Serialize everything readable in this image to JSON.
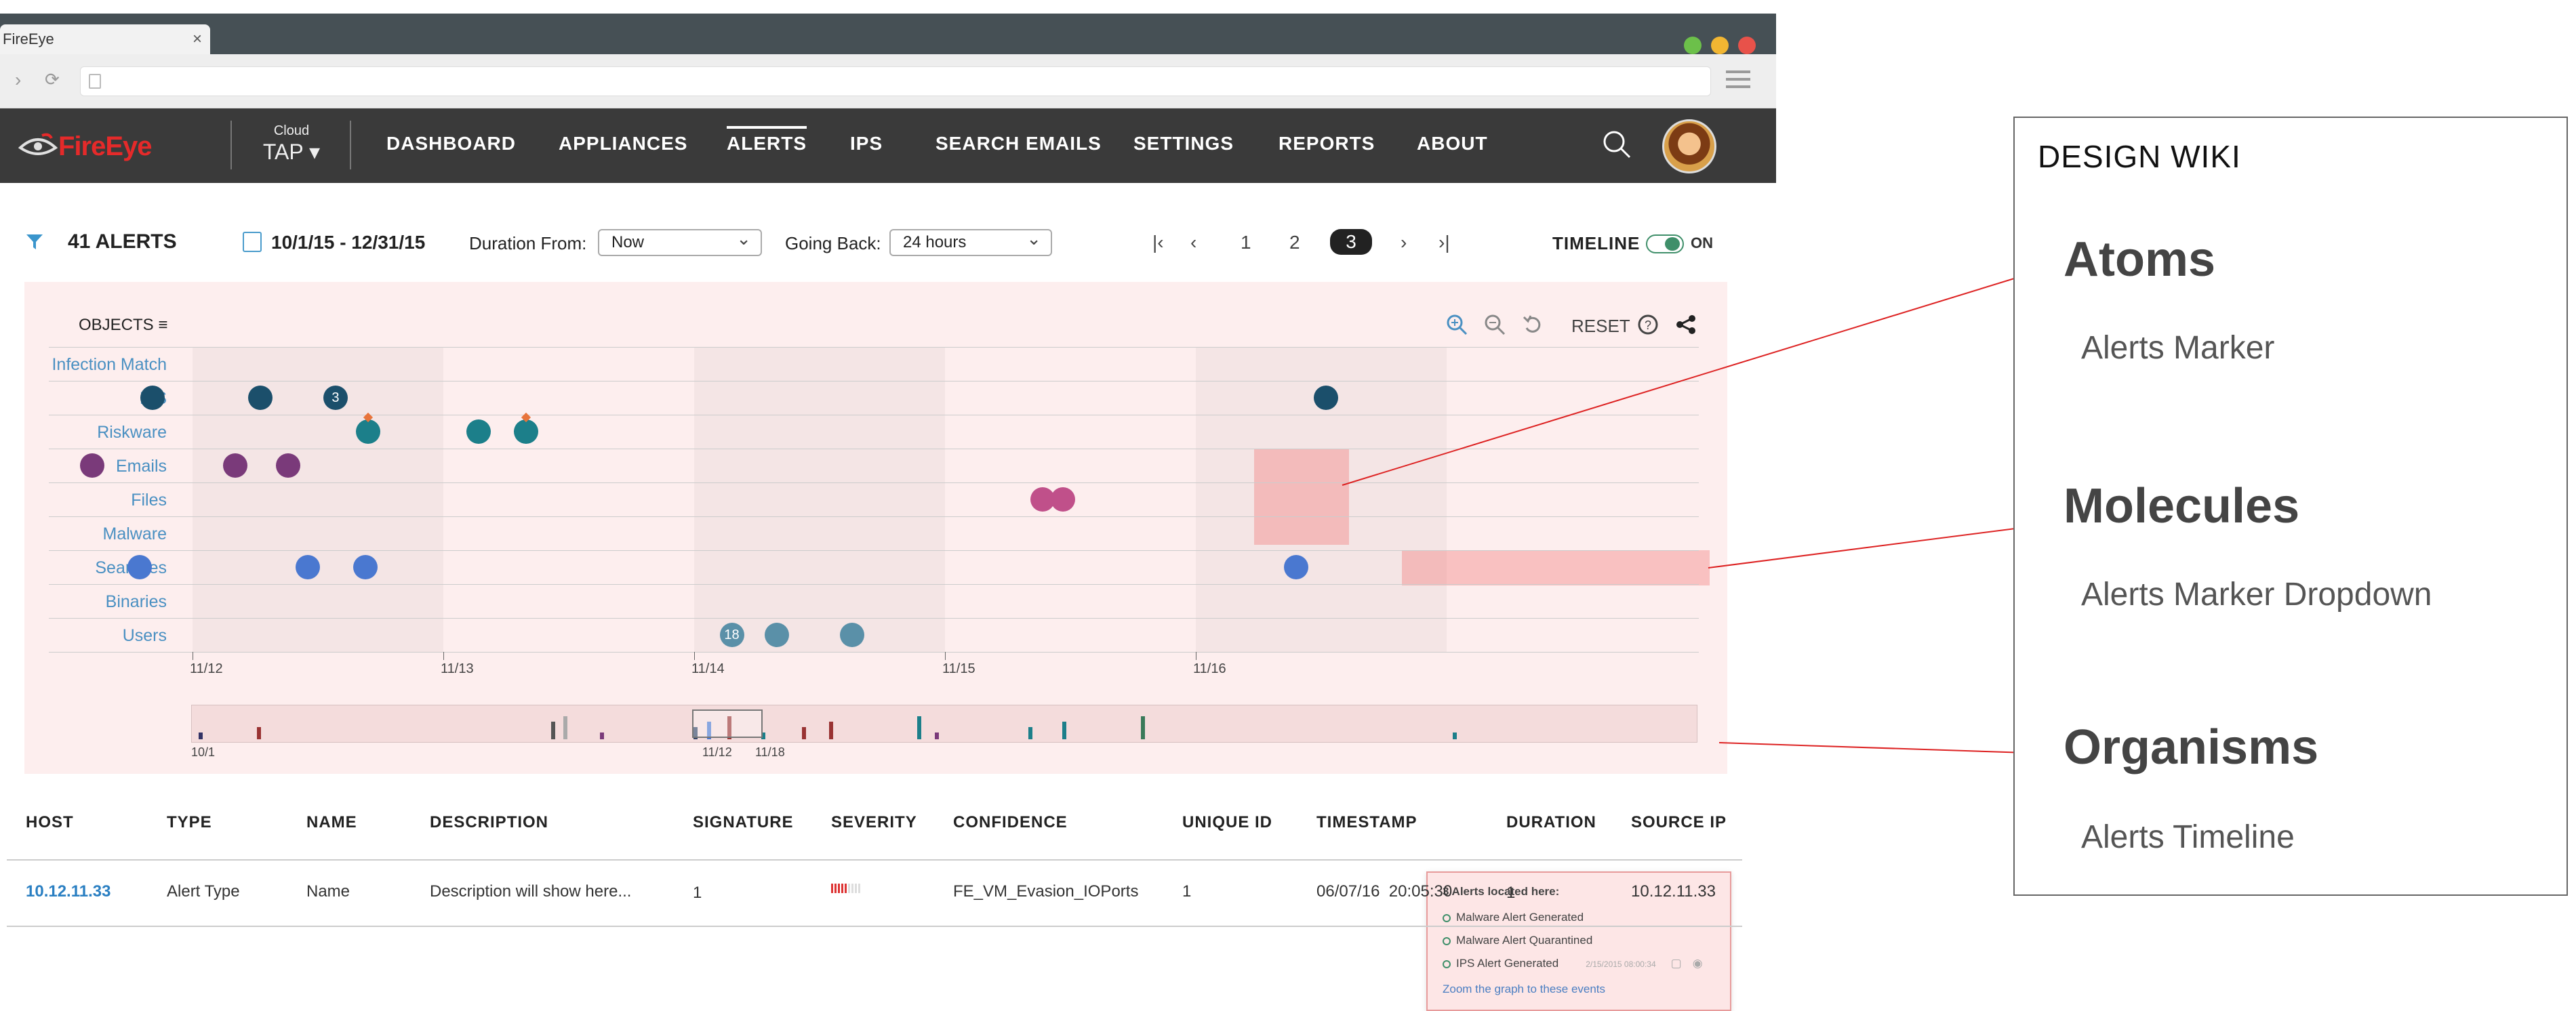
{
  "browser": {
    "tab_title": "FireEye",
    "tab_close": "×",
    "back": "›",
    "reload": "⟳"
  },
  "nav": {
    "logo_text": "FireEye",
    "cloud_small": "Cloud",
    "cloud_big": "TAP ▾",
    "items": [
      "DASHBOARD",
      "APPLIANCES",
      "ALERTS",
      "IPS",
      "SEARCH EMAILS",
      "SETTINGS",
      "REPORTS",
      "ABOUT"
    ],
    "active": "ALERTS"
  },
  "filters": {
    "alerts_count": "41 ALERTS",
    "date_range": "10/1/15 - 12/31/15",
    "duration_label": "Duration From:",
    "duration_value": "Now",
    "going_back_label": "Going Back:",
    "going_back_value": "24 hours",
    "pages": [
      "1",
      "2",
      "3"
    ],
    "current_page": "3",
    "timeline_label": "TIMELINE",
    "timeline_state": "ON"
  },
  "chart_data": {
    "type": "scatter",
    "objects_label": "OBJECTS ≡",
    "tools": {
      "reset": "RESET"
    },
    "categories": [
      "Infection Match",
      "IPS",
      "Riskware",
      "Emails",
      "Files",
      "Malware",
      "Searches",
      "Binaries",
      "Users"
    ],
    "x_ticks": [
      "11/12",
      "11/13",
      "11/14",
      "11/15",
      "11/16"
    ],
    "series_colors": {
      "IPS": "#1b4f6b",
      "Riskware": "#1c7f8a",
      "Emails": "#7a3a7a",
      "Files": "#c0508a",
      "Searches": "#4a78d0",
      "Users": "#5a90a8"
    },
    "points": [
      {
        "cat": "IPS",
        "x": 11.84
      },
      {
        "cat": "IPS",
        "x": 12.27
      },
      {
        "cat": "IPS",
        "x": 12.57,
        "label": "3"
      },
      {
        "cat": "IPS",
        "x": 16.52
      },
      {
        "cat": "Riskware",
        "x": 12.7,
        "flag": true
      },
      {
        "cat": "Riskware",
        "x": 13.14
      },
      {
        "cat": "Riskware",
        "x": 13.33,
        "flag": true
      },
      {
        "cat": "Emails",
        "x": 11.6
      },
      {
        "cat": "Emails",
        "x": 12.17
      },
      {
        "cat": "Emails",
        "x": 12.38
      },
      {
        "cat": "Files",
        "x": 15.39
      },
      {
        "cat": "Files",
        "x": 15.47
      },
      {
        "cat": "Searches",
        "x": 11.79
      },
      {
        "cat": "Searches",
        "x": 12.46
      },
      {
        "cat": "Searches",
        "x": 12.69
      },
      {
        "cat": "Searches",
        "x": 16.4
      },
      {
        "cat": "Users",
        "x": 14.15,
        "label": "18"
      },
      {
        "cat": "Users",
        "x": 14.33
      },
      {
        "cat": "Users",
        "x": 14.63
      }
    ],
    "brush_labels": [
      "10/1",
      "11/12",
      "11/18"
    ]
  },
  "popup": {
    "title": "3 Alerts located here:",
    "items": [
      "Malware Alert Generated",
      "Malware Alert Quarantined",
      "IPS Alert Generated"
    ],
    "ts": "2/15/2015 08:00:34",
    "link": "Zoom the graph to these events"
  },
  "table": {
    "headers": [
      "HOST",
      "TYPE",
      "NAME",
      "DESCRIPTION",
      "SIGNATURE",
      "SEVERITY",
      "CONFIDENCE",
      "UNIQUE ID",
      "TIMESTAMP",
      "DURATION",
      "SOURCE IP"
    ],
    "rows": [
      [
        "10.12.11.33",
        "Alert Type",
        "Name",
        "Description will show here...",
        "1",
        "",
        "FE_VM_Evasion_IOPorts",
        "1",
        "06/07/16  20:05:30",
        "1",
        "10.12.11.33"
      ]
    ]
  },
  "wiki": {
    "title": "DESIGN WIKI",
    "sections": [
      {
        "heading": "Atoms",
        "sub": "Alerts Marker"
      },
      {
        "heading": "Molecules",
        "sub": "Alerts Marker Dropdown"
      },
      {
        "heading": "Organisms",
        "sub": "Alerts Timeline"
      }
    ]
  }
}
